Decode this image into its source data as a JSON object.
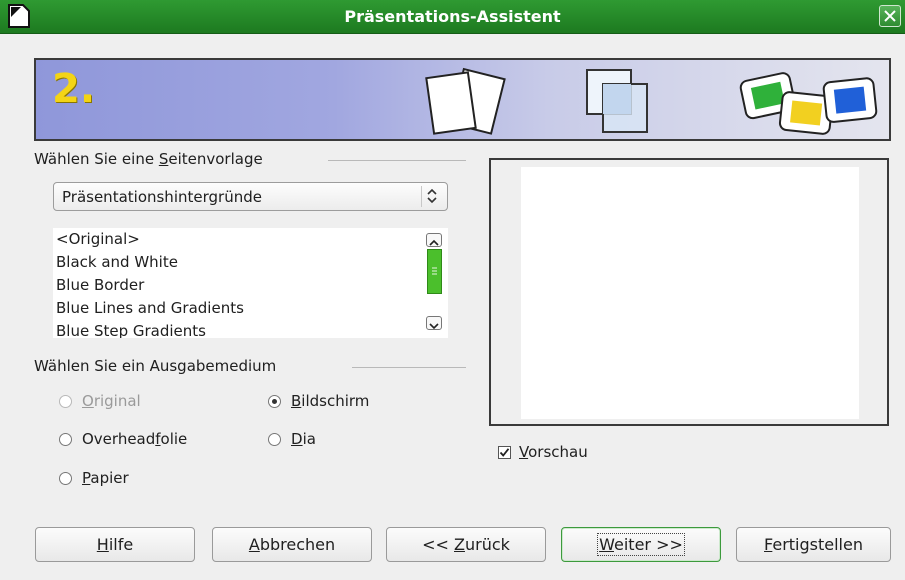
{
  "window": {
    "title": "Präsentations-Assistent"
  },
  "banner": {
    "step_number": "2."
  },
  "page_template": {
    "legend_pre": "Wählen Sie eine ",
    "legend_mnemonic": "S",
    "legend_post": "eitenvorlage",
    "category_selected": "Präsentationshintergründe",
    "templates": [
      "<Original>",
      "Black and White",
      "Blue Border",
      "Blue Lines and Gradients",
      "Blue Step Gradients"
    ]
  },
  "output_medium": {
    "legend": "Wählen Sie ein Ausgabemedium",
    "options": {
      "original": {
        "pre": "",
        "mnemonic": "O",
        "post": "riginal"
      },
      "screen": {
        "pre": "",
        "mnemonic": "B",
        "post": "ildschirm"
      },
      "overhead": {
        "pre": "Overhead",
        "mnemonic": "f",
        "post": "olie"
      },
      "slide": {
        "pre": "",
        "mnemonic": "D",
        "post": "ia"
      },
      "paper": {
        "pre": "",
        "mnemonic": "P",
        "post": "apier"
      }
    },
    "selected": "Bildschirm"
  },
  "preview": {
    "checkbox": {
      "pre": "",
      "mnemonic": "V",
      "post": "orschau",
      "checked": true
    }
  },
  "buttons": {
    "help": {
      "pre": "",
      "mnemonic": "H",
      "post": "ilfe"
    },
    "cancel": {
      "pre": "",
      "mnemonic": "A",
      "post": "bbrechen"
    },
    "back": {
      "pre": "<< ",
      "mnemonic": "Z",
      "post": "urück"
    },
    "next": {
      "pre": "",
      "mnemonic": "W",
      "post": "eiter >>"
    },
    "finish": {
      "pre": "",
      "mnemonic": "F",
      "post": "ertigstellen"
    }
  },
  "icons": {
    "app": "document-icon",
    "close": "close-icon",
    "banner": [
      "pages-icon",
      "overlap-pages-icon",
      "slides-icon"
    ]
  },
  "colors": {
    "titlebar": "#2f9a32",
    "accent": "#4bbf2c",
    "step_number": "#f3d415"
  }
}
